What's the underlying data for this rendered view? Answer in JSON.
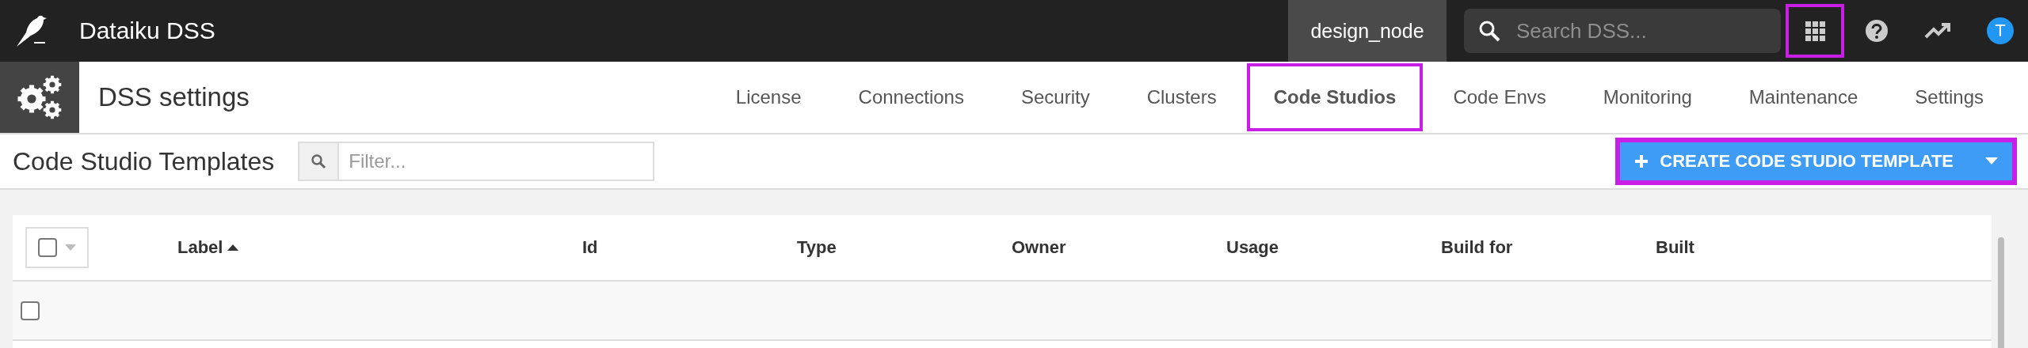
{
  "top_bar": {
    "app_title": "Dataiku DSS",
    "node": "design_node",
    "search": {
      "placeholder": "Search DSS..."
    },
    "icons": [
      {
        "kind": "apps",
        "highlighted": true
      },
      {
        "kind": "help",
        "highlighted": false
      },
      {
        "kind": "trend",
        "highlighted": false
      },
      {
        "kind": "avatar",
        "highlighted": false,
        "initial": "T"
      }
    ]
  },
  "settings_bar": {
    "title": "DSS settings",
    "tabs": [
      {
        "label": "License",
        "selected": false,
        "highlighted": false
      },
      {
        "label": "Connections",
        "selected": false,
        "highlighted": false
      },
      {
        "label": "Security",
        "selected": false,
        "highlighted": false
      },
      {
        "label": "Clusters",
        "selected": false,
        "highlighted": false
      },
      {
        "label": "Code Studios",
        "selected": true,
        "highlighted": true
      },
      {
        "label": "Code Envs",
        "selected": false,
        "highlighted": false
      },
      {
        "label": "Monitoring",
        "selected": false,
        "highlighted": false
      },
      {
        "label": "Maintenance",
        "selected": false,
        "highlighted": false
      },
      {
        "label": "Settings",
        "selected": false,
        "highlighted": false
      }
    ]
  },
  "toolbar": {
    "title": "Code Studio Templates",
    "filter": {
      "placeholder": "Filter..."
    },
    "create_button": {
      "label": "CREATE CODE STUDIO TEMPLATE",
      "highlighted": true
    }
  },
  "table": {
    "select_all": {
      "checked": false
    },
    "columns": [
      {
        "label": "Label",
        "sorted": true
      },
      {
        "label": "Id",
        "sorted": false
      },
      {
        "label": "Type",
        "sorted": false
      },
      {
        "label": "Owner",
        "sorted": false
      },
      {
        "label": "Usage",
        "sorted": false
      },
      {
        "label": "Build for",
        "sorted": false
      },
      {
        "label": "Built",
        "sorted": false
      }
    ],
    "rows": [
      {
        "checked": false
      }
    ]
  }
}
